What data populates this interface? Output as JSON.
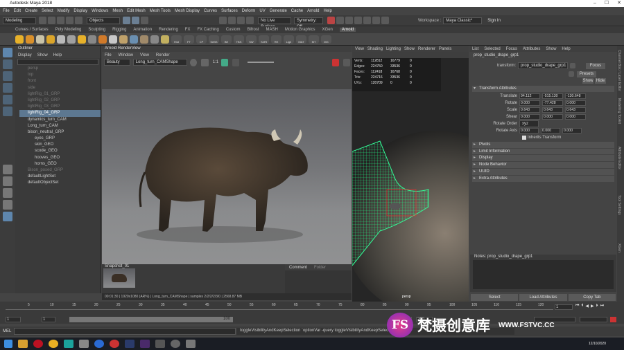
{
  "window": {
    "title": "Autodesk Maya 2018"
  },
  "menu": [
    "File",
    "Edit",
    "Create",
    "Select",
    "Modify",
    "Display",
    "Windows",
    "Mesh",
    "Edit Mesh",
    "Mesh Tools",
    "Mesh Display",
    "Curves",
    "Surfaces",
    "Deform",
    "UV",
    "Generate",
    "Cache",
    "Arnold",
    "Help"
  ],
  "status": {
    "menuset": "Modeling",
    "objects": "Objects",
    "live_surface": "No Live Surface",
    "symmetry": "Symmetry: Off",
    "workspace_label": "Workspace :",
    "workspace": "Maya Classic*",
    "sign_in": "Sign In"
  },
  "shelf_tabs": [
    "Curves / Surfaces",
    "Poly Modeling",
    "Sculpting",
    "Rigging",
    "Animation",
    "Rendering",
    "FX",
    "FX Caching",
    "Custom",
    "Bifrost",
    "MASH",
    "Motion Graphics",
    "XGen",
    "Arnold"
  ],
  "shelf_active": "Arnold",
  "shelf_labels": [
    "Hist",
    "FT",
    "CP",
    "SeBS",
    "BE",
    "TBS",
    "SW",
    "SeRt",
    "RE",
    "Ligh",
    "MAT",
    "MT",
    "MG"
  ],
  "outliner": {
    "title": "Outliner",
    "menu": [
      "Display",
      "Show",
      "Help"
    ],
    "items": [
      {
        "label": "persp",
        "dim": true,
        "indent": 0
      },
      {
        "label": "top",
        "dim": true,
        "indent": 0
      },
      {
        "label": "front",
        "dim": true,
        "indent": 0
      },
      {
        "label": "side",
        "dim": true,
        "indent": 0
      },
      {
        "label": "lightRig_01_GRP",
        "dim": true,
        "indent": 0
      },
      {
        "label": "lightRig_02_GRP",
        "dim": true,
        "indent": 0
      },
      {
        "label": "lightRig_03_GRP",
        "dim": true,
        "indent": 0
      },
      {
        "label": "lightRig_04_GRP",
        "dim": false,
        "indent": 0,
        "selected": true
      },
      {
        "label": "dynamics_turn_CAM",
        "dim": false,
        "indent": 0
      },
      {
        "label": "Long_turn_CAM",
        "dim": false,
        "indent": 0
      },
      {
        "label": "bison_neutral_GRP",
        "dim": false,
        "indent": 0
      },
      {
        "label": "eyes_GRP",
        "dim": false,
        "indent": 1
      },
      {
        "label": "skin_GEO",
        "dim": false,
        "indent": 1
      },
      {
        "label": "scode_GEO",
        "dim": false,
        "indent": 1
      },
      {
        "label": "hooves_GEO",
        "dim": false,
        "indent": 1
      },
      {
        "label": "horns_GEO",
        "dim": false,
        "indent": 1
      },
      {
        "label": "Bison_posed_GRP",
        "dim": true,
        "indent": 0
      },
      {
        "label": "defaultLightSet",
        "dim": false,
        "indent": 0
      },
      {
        "label": "defaultObjectSet",
        "dim": false,
        "indent": 0
      }
    ]
  },
  "renderview": {
    "title": "Arnold RenderView",
    "menu": [
      "File",
      "Window",
      "View",
      "Render"
    ],
    "mode": "Beauty",
    "camera": "Long_turn_CAMShape",
    "ratio": "1:1",
    "snapshot": "Snapshot_01",
    "status": "00:01:30 | 1920x1080 (AR%) | Long_turn_CAMShape | samples 2/2/2/2/3/0 | 2568.87 MB",
    "tabs": [
      "Comment",
      "Folder"
    ]
  },
  "viewport": {
    "menu": [
      "View",
      "Shading",
      "Lighting",
      "Show",
      "Renderer",
      "Panels"
    ],
    "camera": "persp",
    "stats": [
      {
        "k": "Verts:",
        "a": "112812",
        "b": "16779",
        "c": "0"
      },
      {
        "k": "Edges:",
        "a": "224750",
        "b": "33536",
        "c": "0"
      },
      {
        "k": "Faces:",
        "a": "112418",
        "b": "16768",
        "c": "0"
      },
      {
        "k": "Tris:",
        "a": "224716",
        "b": "33536",
        "c": "0"
      },
      {
        "k": "UVs:",
        "a": "120709",
        "b": "0",
        "c": "0"
      }
    ]
  },
  "attr": {
    "menu": [
      "List",
      "Selected",
      "Focus",
      "Attributes",
      "Show",
      "Help"
    ],
    "node": "prop_studio_drape_grp1",
    "transform_label": "transform:",
    "transform": "prop_studio_drape_grp1",
    "focus": "Focus",
    "presets": "Presets",
    "show": "Show",
    "hide": "Hide",
    "section": "Transform Attributes",
    "rows": [
      {
        "l": "Translate",
        "v": [
          "94.112",
          "-515.130",
          "-130.648"
        ]
      },
      {
        "l": "Rotate",
        "v": [
          "0.000",
          "-77.428",
          "0.000"
        ]
      },
      {
        "l": "Scale",
        "v": [
          "0.643",
          "0.643",
          "0.643"
        ]
      },
      {
        "l": "Shear",
        "v": [
          "0.000",
          "0.000",
          "0.000"
        ]
      }
    ],
    "rotate_order_label": "Rotate Order",
    "rotate_order": "xyz",
    "rotate_axis_label": "Rotate Axis",
    "rotate_axis": [
      "0.000",
      "0.000",
      "0.000"
    ],
    "inherits": "Inherits Transform",
    "sections": [
      "Pivots",
      "Limit Information",
      "Display",
      "Node Behavior",
      "UUID",
      "Extra Attributes"
    ],
    "notes": "Notes: prop_studio_drape_grp1",
    "buttons": [
      "Select",
      "Load Attributes",
      "Copy Tab"
    ]
  },
  "sidebar": [
    "Channel Box / Layer Editor",
    "Modelling Toolkit",
    "Attribute Editor",
    "Tool Settings",
    "XGen"
  ],
  "time": {
    "ticks": [
      "5",
      "10",
      "15",
      "20",
      "25",
      "30",
      "35",
      "40",
      "45",
      "50",
      "55",
      "60",
      "65",
      "70",
      "75",
      "80",
      "85",
      "90",
      "95",
      "100",
      "105",
      "110",
      "115",
      "120"
    ],
    "current": "1",
    "start": "1",
    "range_start": "1",
    "range_end": "120",
    "end": "120",
    "end2": "200",
    "range_mid": "100"
  },
  "cmd": {
    "lang": "MEL",
    "text": "toggleVisibilityAndKeepSelection `optionVar -query toggleVisibilityAndKeepSelection`"
  },
  "watermark": {
    "brand": "FS",
    "cn": "梵摄创意库",
    "url": "WWW.FSTVC.CC"
  },
  "taskbar": {
    "date": "12/10/2020"
  }
}
